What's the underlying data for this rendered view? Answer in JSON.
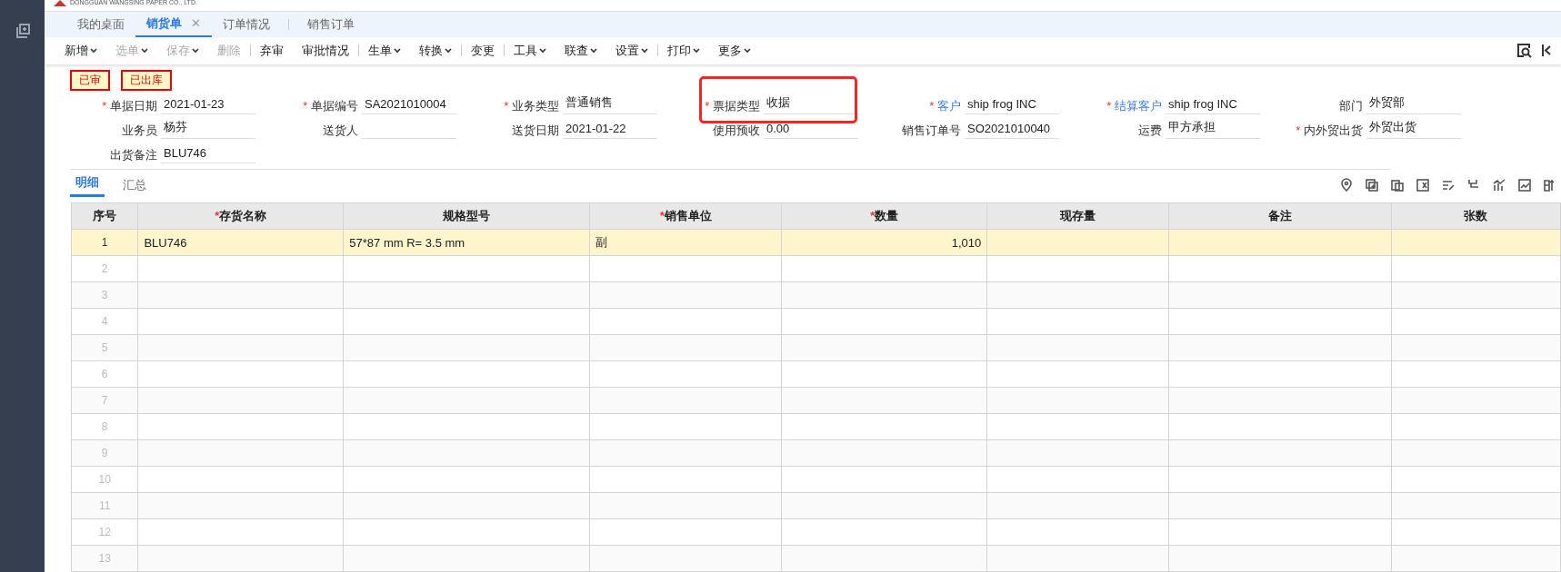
{
  "header": {
    "company": "DONGGUAN WANGSING PAPER CO., LTD."
  },
  "tabs": [
    {
      "label": "我的桌面",
      "selected": false
    },
    {
      "label": "销货单",
      "selected": true,
      "close": "✕"
    },
    {
      "label": "订单情况",
      "selected": false
    },
    {
      "label": "销售订单",
      "selected": false
    }
  ],
  "toolbar": [
    {
      "label": "新增",
      "dropdown": true,
      "disabled": false,
      "separator": false
    },
    {
      "label": "选单",
      "dropdown": true,
      "disabled": true,
      "separator": false
    },
    {
      "label": "保存",
      "dropdown": true,
      "disabled": true,
      "separator": false
    },
    {
      "label": "删除",
      "dropdown": false,
      "disabled": true,
      "separator": false
    },
    {
      "label": "弃审",
      "dropdown": false,
      "disabled": false,
      "separator": true
    },
    {
      "label": "审批情况",
      "dropdown": false,
      "disabled": false,
      "separator": false
    },
    {
      "label": "生单",
      "dropdown": true,
      "disabled": false,
      "separator": true
    },
    {
      "label": "转换",
      "dropdown": true,
      "disabled": false,
      "separator": false
    },
    {
      "label": "变更",
      "dropdown": false,
      "disabled": false,
      "separator": true
    },
    {
      "label": "工具",
      "dropdown": true,
      "disabled": false,
      "separator": true
    },
    {
      "label": "联查",
      "dropdown": true,
      "disabled": false,
      "separator": false
    },
    {
      "label": "设置",
      "dropdown": true,
      "disabled": false,
      "separator": false
    },
    {
      "label": "打印",
      "dropdown": true,
      "disabled": false,
      "separator": true
    },
    {
      "label": "更多",
      "dropdown": true,
      "disabled": false,
      "separator": false
    }
  ],
  "status_badges": [
    "已审",
    "已出库"
  ],
  "form_rows": [
    [
      {
        "required_mark": "*",
        "label": "单据日期",
        "value": "2021-01-23",
        "link": false
      },
      {
        "required_mark": "*",
        "label": "单据编号",
        "value": "SA2021010004",
        "link": false
      },
      {
        "required_mark": "*",
        "label": "业务类型",
        "value": "普通销售",
        "link": false
      },
      {
        "required_mark": "*",
        "label": "票据类型",
        "value": "收据",
        "link": false
      },
      {
        "required_mark": "*",
        "label": "客户",
        "value": "ship frog INC",
        "link": true
      },
      {
        "required_mark": "*",
        "label": "结算客户",
        "value": "ship frog INC",
        "link": true
      },
      {
        "label": "部门",
        "value": "外贸部",
        "link": false
      }
    ],
    [
      {
        "label": "业务员",
        "value": "杨芬",
        "link": false
      },
      {
        "label": "送货人",
        "link": false
      },
      {
        "label": "送货日期",
        "value": "2021-01-22",
        "link": false
      },
      {
        "label": "使用预收",
        "value": "0.00",
        "link": false
      },
      {
        "label": "销售订单号",
        "value": "SO2021010040",
        "link": false
      },
      {
        "label": "运费",
        "value": "甲方承担",
        "link": false
      },
      {
        "required_mark": "*",
        "label": "内外贸出货",
        "value": "外贸出货",
        "link": false
      }
    ],
    [
      {
        "label": "出货备注",
        "value": "BLU746",
        "link": false
      }
    ]
  ],
  "detail_tabs": [
    {
      "label": "明细",
      "selected": true
    },
    {
      "label": "汇总",
      "selected": false
    }
  ],
  "table": {
    "columns": [
      {
        "label": "序号"
      },
      {
        "required_mark": "*",
        "label": "存货名称"
      },
      {
        "label": "规格型号"
      },
      {
        "required_mark": "*",
        "label": "销售单位"
      },
      {
        "required_mark": "*",
        "label": "数量"
      },
      {
        "label": "现存量"
      },
      {
        "label": "备注"
      },
      {
        "label": "张数"
      }
    ],
    "rows": [
      {
        "cells": [
          "1",
          "BLU746",
          "57*87 mm R= 3.5 mm",
          "副",
          "1,010",
          "",
          "",
          ""
        ],
        "selected": true
      },
      {
        "cells": [
          "2",
          "",
          "",
          "",
          "",
          "",
          "",
          ""
        ],
        "selected": false
      },
      {
        "cells": [
          "3",
          "",
          "",
          "",
          "",
          "",
          "",
          ""
        ],
        "selected": false
      },
      {
        "cells": [
          "4",
          "",
          "",
          "",
          "",
          "",
          "",
          ""
        ],
        "selected": false
      },
      {
        "cells": [
          "5",
          "",
          "",
          "",
          "",
          "",
          "",
          ""
        ],
        "selected": false
      },
      {
        "cells": [
          "6",
          "",
          "",
          "",
          "",
          "",
          "",
          ""
        ],
        "selected": false
      },
      {
        "cells": [
          "7",
          "",
          "",
          "",
          "",
          "",
          "",
          ""
        ],
        "selected": false
      },
      {
        "cells": [
          "8",
          "",
          "",
          "",
          "",
          "",
          "",
          ""
        ],
        "selected": false
      },
      {
        "cells": [
          "9",
          "",
          "",
          "",
          "",
          "",
          "",
          ""
        ],
        "selected": false
      },
      {
        "cells": [
          "10",
          "",
          "",
          "",
          "",
          "",
          "",
          ""
        ],
        "selected": false
      },
      {
        "cells": [
          "11",
          "",
          "",
          "",
          "",
          "",
          "",
          ""
        ],
        "selected": false
      },
      {
        "cells": [
          "12",
          "",
          "",
          "",
          "",
          "",
          "",
          ""
        ],
        "selected": false
      },
      {
        "cells": [
          "13",
          "",
          "",
          "",
          "",
          "",
          "",
          ""
        ],
        "selected": false
      }
    ]
  }
}
